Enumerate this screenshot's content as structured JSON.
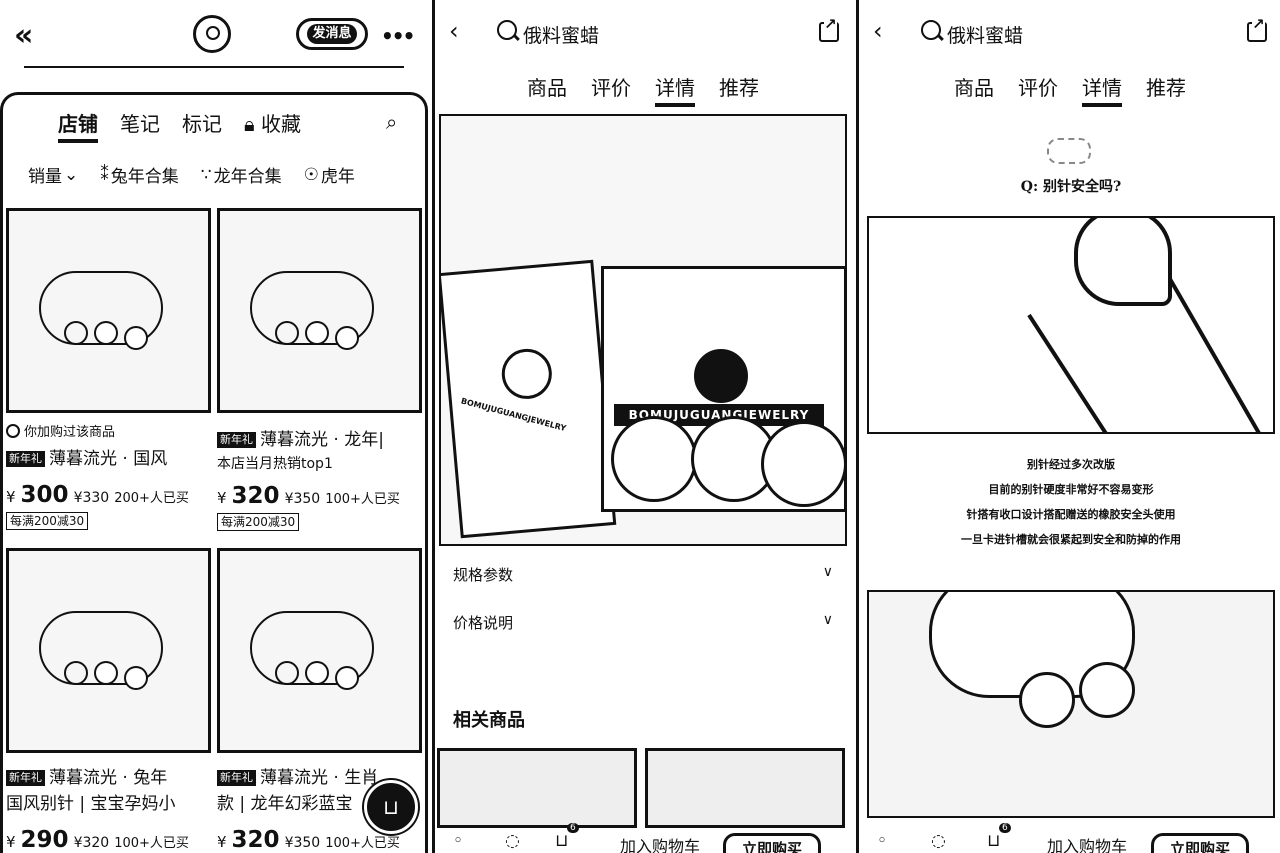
{
  "panel1": {
    "subscribe_label": "发消息",
    "tabs": [
      "店铺",
      "笔记",
      "标记",
      "收藏"
    ],
    "filters": [
      "销量",
      "兔年合集",
      "龙年合集",
      "虎年"
    ],
    "products": [
      {
        "note": "你加购过该商品",
        "tag": "新年礼",
        "title": "薄暮流光 · 国风",
        "subtitle": "",
        "currency": "¥",
        "price": "300",
        "orig": "¥330",
        "sold": "200+人已买",
        "promo": "每满200减30"
      },
      {
        "note": "",
        "tag": "新年礼",
        "title": "薄暮流光 · 龙年|",
        "subtitle": "本店当月热销top1",
        "currency": "¥",
        "price": "320",
        "orig": "¥350",
        "sold": "100+人已买",
        "promo": "每满200减30"
      },
      {
        "tag": "新年礼",
        "title": "薄暮流光 · 兔年",
        "title2": "国风别针 | 宝宝孕妈小",
        "currency": "¥",
        "price": "290",
        "orig": "¥320",
        "sold": "100+人已买"
      },
      {
        "tag": "新年礼",
        "title": "薄暮流光 · 生肖",
        "title2": "款 | 龙年幻彩蓝宝",
        "currency": "¥",
        "price": "320",
        "orig": "¥350",
        "sold": "100+人已买"
      }
    ]
  },
  "panel2": {
    "query": "俄料蜜蜡",
    "subtabs": [
      "商品",
      "评价",
      "详情",
      "推荐"
    ],
    "bag_text": "BOMUJUGUANGJEWELRY",
    "box_text": "BOMUJUGUANGJEWELRY",
    "spec_label": "规格参数",
    "price_label": "价格说明",
    "related_label": "相关商品",
    "cart_count": "6",
    "add_cart": "加入购物车",
    "buy_now": "立即购买"
  },
  "panel3": {
    "query": "俄料蜜蜡",
    "subtabs": [
      "商品",
      "评价",
      "详情",
      "推荐"
    ],
    "question": "Q:  别针安全吗?",
    "answer_lines": [
      "别针经过多次改版",
      "目前的别针硬度非常好不容易变形",
      "针搭有收口设计搭配赠送的橡胶安全头使用",
      "一旦卡进针槽就会很紧起到安全和防掉的作用"
    ],
    "cart_count": "6",
    "add_cart": "加入购物车",
    "buy_now": "立即购买"
  }
}
